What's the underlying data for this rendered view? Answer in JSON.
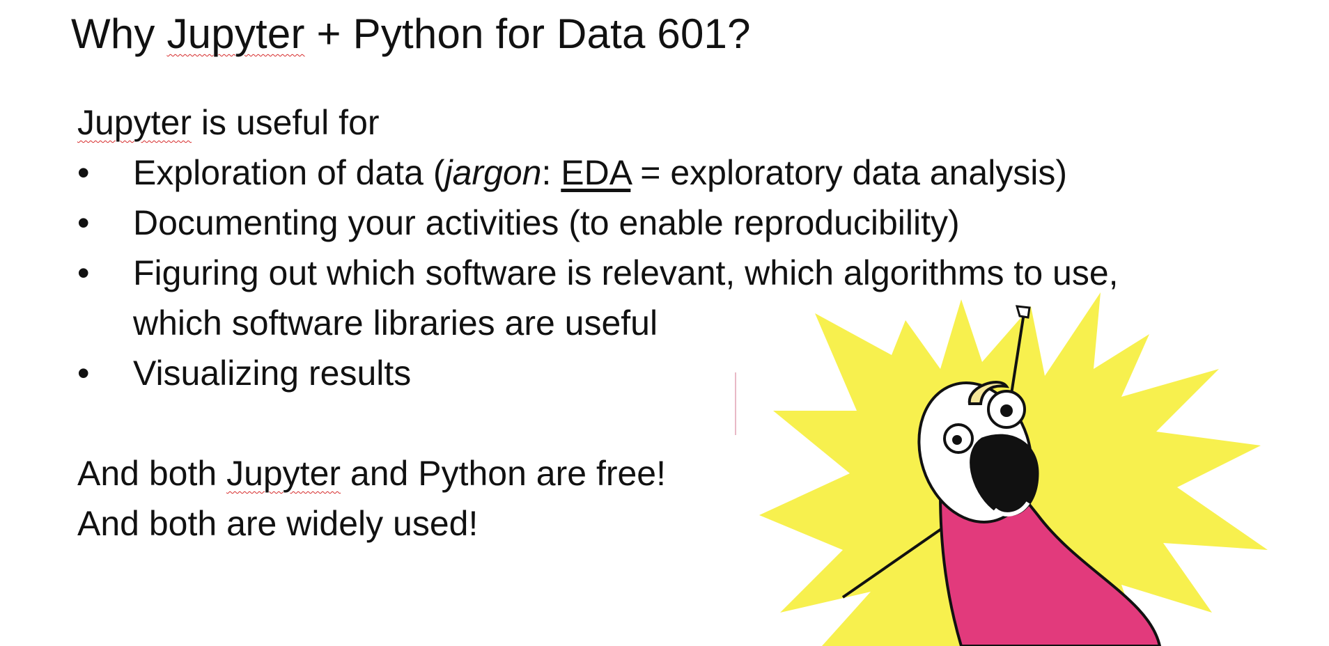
{
  "slide": {
    "title_prefix": "Why ",
    "title_jupyter": "Jupyter",
    "title_suffix": " + Python for Data 601?",
    "intro_jupyter": "Jupyter",
    "intro_rest": " is useful for",
    "bullets": [
      {
        "symbol": "•",
        "pre": "Exploration of data (",
        "italic": "jargon",
        "colon": ": ",
        "underlined": "EDA",
        "post": " = exploratory data analysis)"
      },
      {
        "symbol": "•",
        "line1": "Documenting your activities (to enable reproducibility)"
      },
      {
        "symbol": "•",
        "line1": "Figuring out which software is relevant, which algorithms to use,",
        "line2": "which software libraries are useful"
      },
      {
        "symbol": "•",
        "line1": "Visualizing results"
      }
    ],
    "closing_1_pre": "And both ",
    "closing_1_jupyter": "Jupyter",
    "closing_1_post": " and Python are free!",
    "closing_2": "And both are widely used!"
  },
  "colors": {
    "burst_yellow": "#f7f04e",
    "shirt_pink": "#e23a7c",
    "hair_yellow": "#f5e79a",
    "spellcheck_red": "#d62a2a"
  },
  "icons": {
    "meme_illustration": "all-the-things-meme"
  }
}
